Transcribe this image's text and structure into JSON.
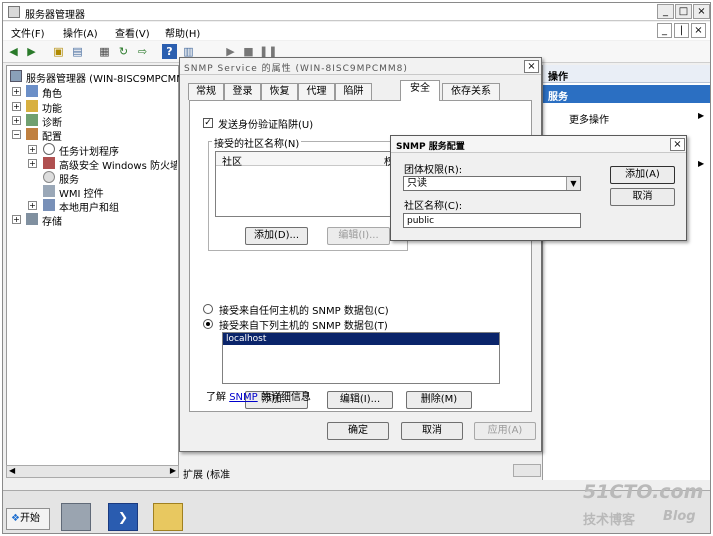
{
  "window": {
    "title": "服务器管理器",
    "controls": [
      "_",
      "□",
      "×"
    ]
  },
  "menu": {
    "items": [
      "文件(F)",
      "操作(A)",
      "查看(V)",
      "帮助(H)"
    ],
    "mdi_controls": [
      "_",
      "|",
      "×"
    ]
  },
  "tree": {
    "root": "服务器管理器 (WIN-8ISC9MPCMM",
    "nodes": {
      "roles": "角色",
      "features": "功能",
      "diagnostics": "诊断",
      "configuration": "配置",
      "task_scheduler": "任务计划程序",
      "firewall": "高级安全 Windows 防火墙",
      "services": "服务",
      "wmi": "WMI 控件",
      "local_users": "本地用户和组",
      "storage": "存储"
    }
  },
  "bottom_tabs": {
    "label": "扩展 (标准"
  },
  "actions": {
    "header": "操作",
    "section": "服务",
    "more": "更多操作"
  },
  "properties_dialog": {
    "title": "SNMP Service 的属性 (WIN-8ISC9MPCMM8)",
    "tabs": [
      "常规",
      "登录",
      "恢复",
      "代理",
      "陷阱",
      "安全",
      "依存关系"
    ],
    "active_tab": "安全",
    "send_auth_trap": "发送身份验证陷阱(U)",
    "accepted_communities_label": "接受的社区名称(N)",
    "community_column": "社区",
    "rights_column": "权",
    "btn_add_community": "添加(D)...",
    "btn_edit_community": "编辑(I)...",
    "radio_any_host": "接受来自任何主机的 SNMP 数据包(C)",
    "radio_these_hosts": "接受来自下列主机的 SNMP 数据包(T)",
    "hosts": [
      "localhost"
    ],
    "btn_add_host": "添加...",
    "btn_edit_host": "编辑(I)...",
    "btn_remove_host": "删除(M)",
    "learn_more_prefix": "了解 ",
    "learn_more_link": "SNMP",
    "learn_more_suffix": " 的详细信息",
    "btn_ok": "确定",
    "btn_cancel": "取消",
    "btn_apply": "应用(A)"
  },
  "snmp_config_dialog": {
    "title": "SNMP 服务配置",
    "rights_label": "团体权限(R):",
    "rights_value": "只读",
    "community_label": "社区名称(C):",
    "community_value": "public",
    "btn_add": "添加(A)",
    "btn_cancel": "取消"
  },
  "taskbar": {
    "start": "开始"
  },
  "watermark": {
    "line1": "51CTO.com",
    "line2": "技术博客",
    "line3": "Blog"
  },
  "colors": {
    "selection": "#0a246a",
    "accent": "#2b6fc2",
    "link": "#0000cc"
  }
}
